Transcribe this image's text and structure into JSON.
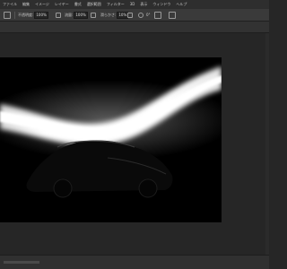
{
  "app": {
    "menu": [
      "ファイル",
      "編集",
      "イメージ",
      "レイヤー",
      "書式",
      "選択範囲",
      "フィルター",
      "3D",
      "表示",
      "ウィンドウ",
      "ヘルプ"
    ]
  },
  "options_bar": {
    "opacity_label": "不透明度:",
    "opacity_value": "100%",
    "flow_label": "流量:",
    "flow_value": "100%",
    "smoothing_label": "滑らかさ:",
    "smoothing_value": "10%",
    "angle_value": "0°"
  },
  "document": {
    "image_description": "dark studio photo: silhouette of a car under a sweeping white light streak"
  },
  "colors": {
    "menubar_bg": "#2e2e2e",
    "options_bg": "#3a3a3a",
    "workspace_bg": "#262626",
    "canvas_bg": "#000000",
    "light_streak": "#ffffff"
  }
}
